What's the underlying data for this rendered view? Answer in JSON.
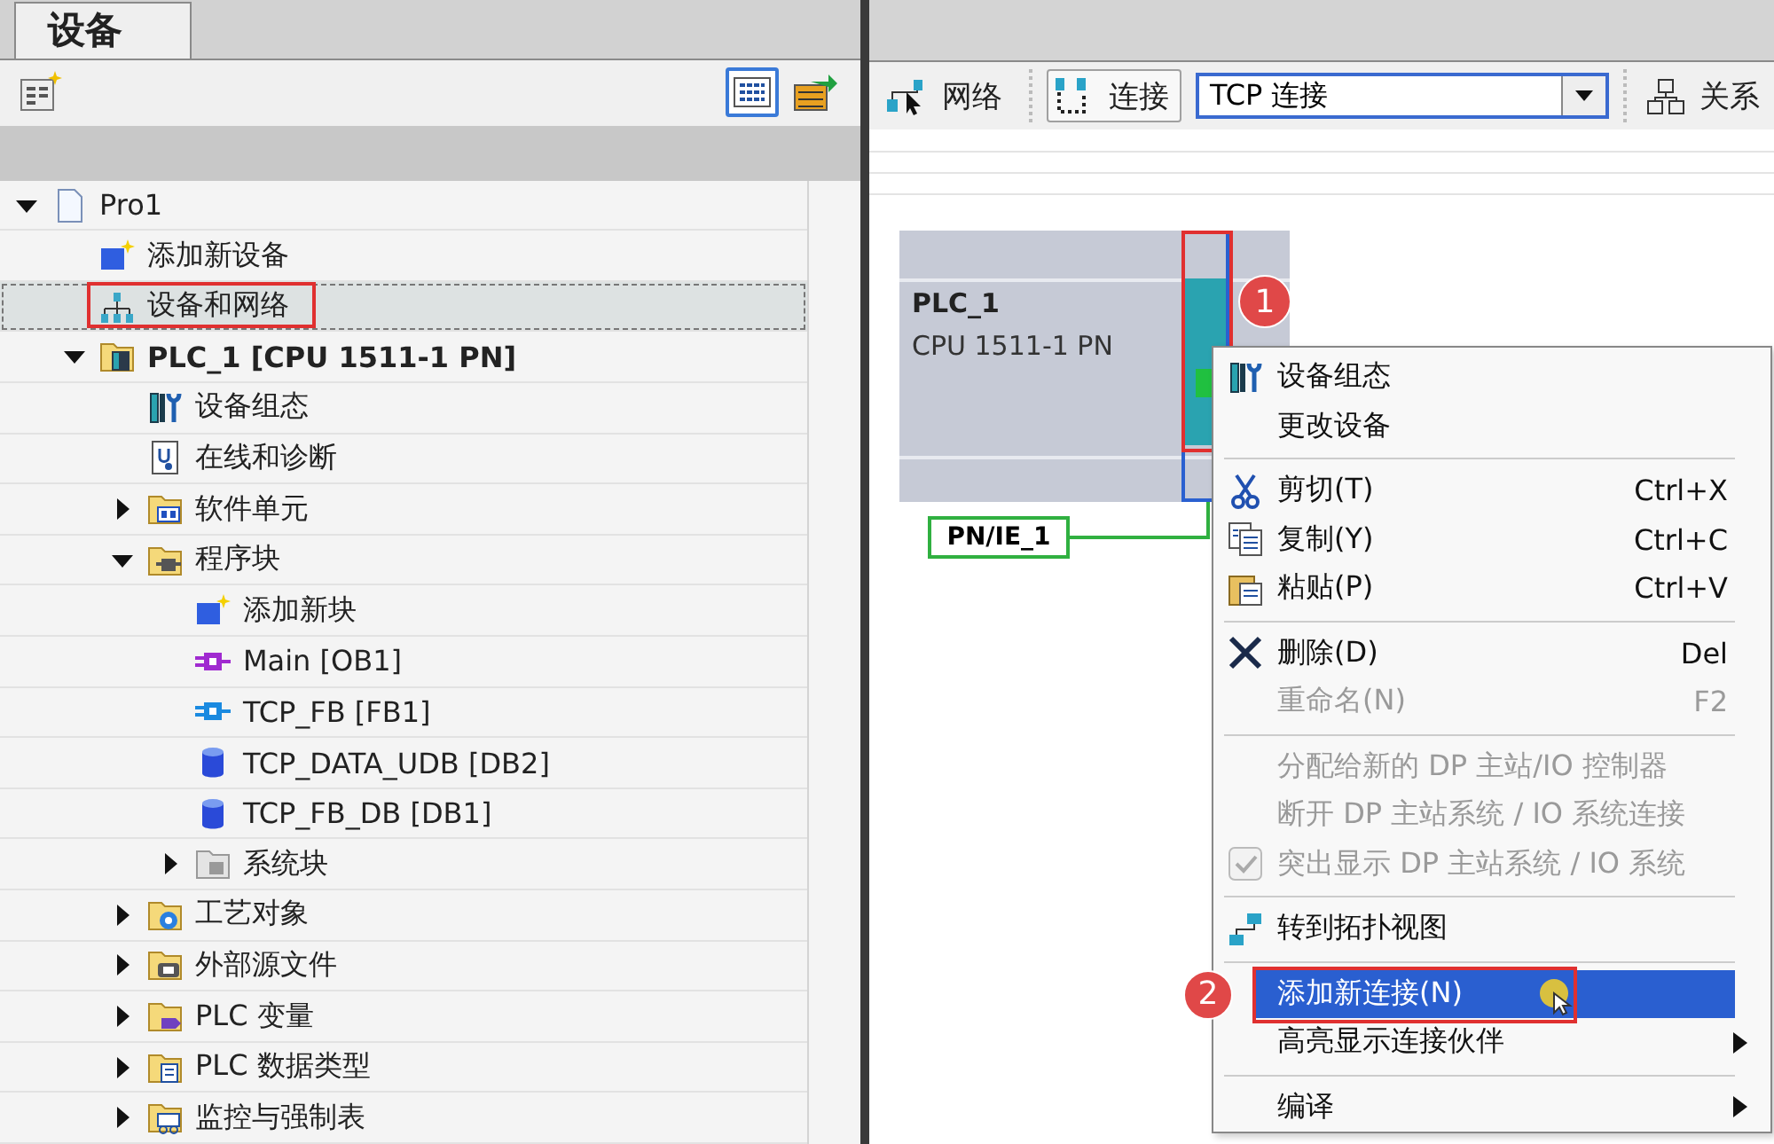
{
  "left_panel": {
    "tab": {
      "label": "设备",
      "selected": true
    },
    "tree": [
      {
        "label": "Pro1",
        "kind": "page",
        "expanded": true,
        "selected": false,
        "annotated": false,
        "children": [
          {
            "label": "添加新设备",
            "kind": "add",
            "selected": false,
            "annotated": false
          },
          {
            "label": "设备和网络",
            "kind": "network",
            "selected": true,
            "annotated": true
          },
          {
            "label": "PLC_1 [CPU 1511-1 PN]",
            "kind": "plc",
            "expanded": true,
            "selected": false,
            "annotated": false,
            "children": [
              {
                "label": "设备组态",
                "kind": "config",
                "selected": false,
                "annotated": false
              },
              {
                "label": "在线和诊断",
                "kind": "diag",
                "selected": false,
                "annotated": false
              },
              {
                "label": "软件单元",
                "kind": "folder-units",
                "expanded": false,
                "selected": false,
                "annotated": false
              },
              {
                "label": "程序块",
                "kind": "folder-blocks",
                "expanded": true,
                "selected": false,
                "annotated": false,
                "children": [
                  {
                    "label": "添加新块",
                    "kind": "add",
                    "selected": false,
                    "annotated": false
                  },
                  {
                    "label": "Main [OB1]",
                    "kind": "ob",
                    "selected": false,
                    "annotated": false
                  },
                  {
                    "label": "TCP_FB [FB1]",
                    "kind": "fb",
                    "selected": false,
                    "annotated": false
                  },
                  {
                    "label": "TCP_DATA_UDB [DB2]",
                    "kind": "db",
                    "selected": false,
                    "annotated": false
                  },
                  {
                    "label": "TCP_FB_DB [DB1]",
                    "kind": "db",
                    "selected": false,
                    "annotated": false
                  },
                  {
                    "label": "系统块",
                    "kind": "folder-system",
                    "expanded": false,
                    "selected": false,
                    "annotated": false
                  }
                ]
              },
              {
                "label": "工艺对象",
                "kind": "folder-tech",
                "expanded": false,
                "selected": false,
                "annotated": false
              },
              {
                "label": "外部源文件",
                "kind": "folder-ext",
                "expanded": false,
                "selected": false,
                "annotated": false
              },
              {
                "label": "PLC 变量",
                "kind": "folder-tags",
                "expanded": false,
                "selected": false,
                "annotated": false
              },
              {
                "label": "PLC 数据类型",
                "kind": "folder-types",
                "expanded": false,
                "selected": false,
                "annotated": false
              },
              {
                "label": "监控与强制表",
                "kind": "folder-watch",
                "expanded": false,
                "selected": false,
                "annotated": false
              }
            ]
          }
        ]
      }
    ]
  },
  "right_panel": {
    "toolbar": {
      "network": "网络",
      "connections": {
        "label": "连接",
        "pressed": true
      },
      "connection_type": "TCP 连接",
      "relations": "关系"
    },
    "diagram": {
      "device": {
        "name": "PLC_1",
        "type": "CPU 1511-1 PN",
        "marker": "1"
      },
      "subnet": "PN/IE_1"
    },
    "context_menu": [
      {
        "kind": "config",
        "label": "设备组态",
        "disabled": false,
        "selected": false
      },
      {
        "kind": "plain",
        "label": "更改设备",
        "disabled": false,
        "selected": false
      },
      {
        "kind": "separator"
      },
      {
        "kind": "cut",
        "label": "剪切(T)",
        "shortcut": "Ctrl+X",
        "disabled": false,
        "selected": false
      },
      {
        "kind": "copy",
        "label": "复制(Y)",
        "shortcut": "Ctrl+C",
        "disabled": false,
        "selected": false
      },
      {
        "kind": "paste",
        "label": "粘贴(P)",
        "shortcut": "Ctrl+V",
        "disabled": false,
        "selected": false
      },
      {
        "kind": "separator"
      },
      {
        "kind": "delete",
        "label": "删除(D)",
        "shortcut": "Del",
        "disabled": false,
        "selected": false
      },
      {
        "kind": "plain",
        "label": "重命名(N)",
        "shortcut": "F2",
        "disabled": true,
        "selected": false
      },
      {
        "kind": "separator"
      },
      {
        "kind": "plain",
        "label": "分配给新的 DP 主站/IO 控制器",
        "disabled": true,
        "selected": false
      },
      {
        "kind": "plain",
        "label": "断开 DP 主站系统 / IO 系统连接",
        "disabled": true,
        "selected": false
      },
      {
        "kind": "checkbox",
        "label": "突出显示 DP 主站系统 / IO 系统",
        "disabled": true,
        "checked": true,
        "selected": false
      },
      {
        "kind": "separator"
      },
      {
        "kind": "topology",
        "label": "转到拓扑视图",
        "disabled": false,
        "selected": false
      },
      {
        "kind": "separator"
      },
      {
        "kind": "plain",
        "label": "添加新连接(N)",
        "disabled": false,
        "selected": true,
        "marker": "2"
      },
      {
        "kind": "plain",
        "label": "高亮显示连接伙伴",
        "disabled": false,
        "selected": false,
        "submenu": true
      },
      {
        "kind": "separator"
      },
      {
        "kind": "plain",
        "label": "编译",
        "disabled": false,
        "selected": false,
        "submenu": true
      }
    ]
  }
}
